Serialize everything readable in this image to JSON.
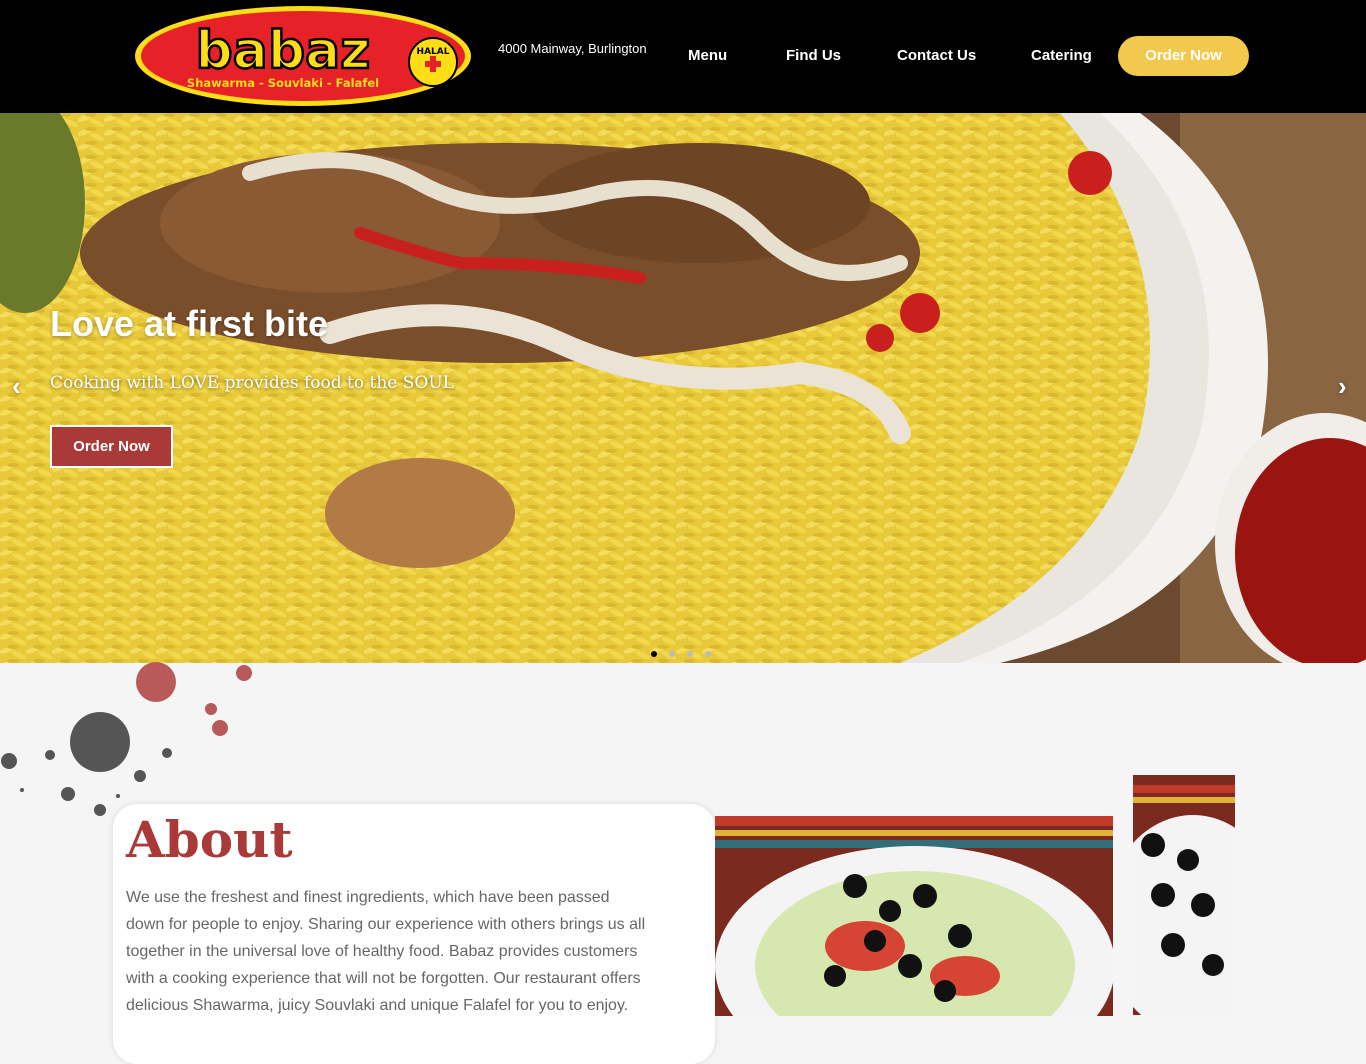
{
  "header": {
    "logo": {
      "name": "babaz",
      "halal": "HALAL",
      "tagline": "Shawarma - Souvlaki - Falafel"
    },
    "address": "4000 Mainway, Burlington",
    "nav": [
      "Menu",
      "Find Us",
      "Contact Us",
      "Catering"
    ],
    "order_button": "Order Now"
  },
  "hero": {
    "title": "Love at first bite",
    "subtitle": "Cooking with LOVE provides food to the SOUL",
    "button": "Order Now",
    "prev_arrow": "‹",
    "next_arrow": "›",
    "slide_count": 4,
    "active_slide": 1
  },
  "about": {
    "title": "About",
    "text": "We use the freshest and finest ingredients, which have been passed down for people to enjoy. Sharing our experience with others brings us all together in the universal love of healthy food. Babaz provides customers with a cooking experience that will not be forgotten. Our restaurant offers delicious Shawarma, juicy Souvlaki and unique Falafel for you to enjoy."
  },
  "colors": {
    "header_bg": "#000000",
    "accent_yellow": "#f2c94c",
    "accent_red": "#a93a37",
    "page_bg": "#f5f5f5"
  }
}
